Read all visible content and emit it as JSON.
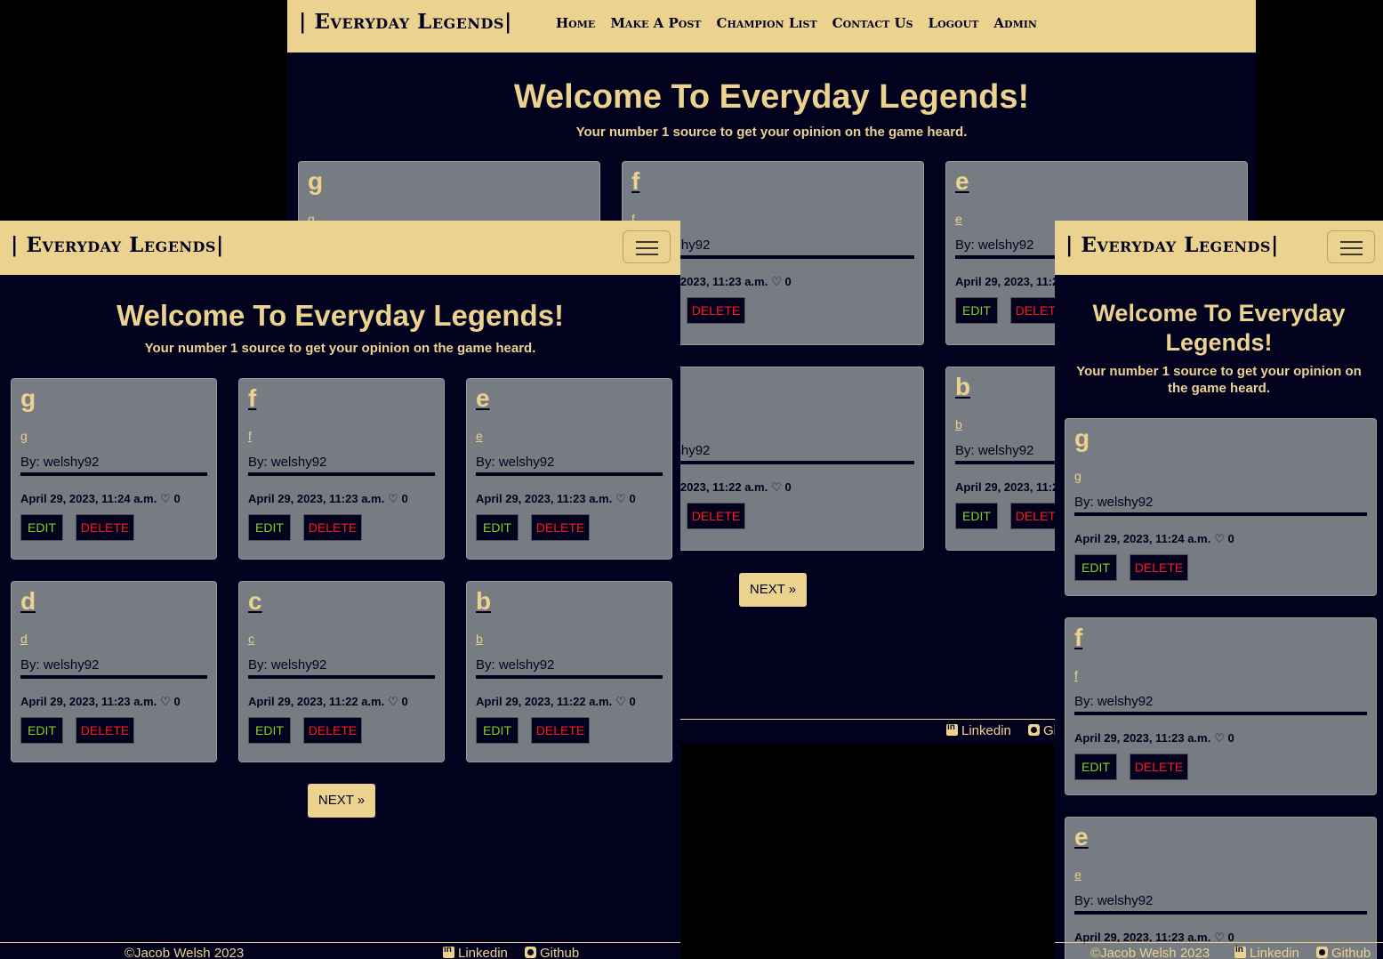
{
  "brand": "| Everyday Legends|",
  "nav": [
    "Home",
    "Make A Post",
    "Champion List",
    "Contact Us",
    "Logout",
    "Admin"
  ],
  "hero": {
    "title": "Welcome To Everyday Legends!",
    "subtitle": "Your number 1 source to get your opinion on the game heard."
  },
  "posts": [
    {
      "title": "g",
      "excerpt": "g",
      "author": "By: welshy92",
      "date": "April 29, 2023, 11:24 a.m.",
      "likes": "0"
    },
    {
      "title": "f",
      "excerpt": "f",
      "author": "By: welshy92",
      "date": "April 29, 2023, 11:23 a.m.",
      "likes": "0"
    },
    {
      "title": "e",
      "excerpt": "e",
      "author": "By: welshy92",
      "date": "April 29, 2023, 11:23 a.m.",
      "likes": "0"
    },
    {
      "title": "d",
      "excerpt": "d",
      "author": "By: welshy92",
      "date": "April 29, 2023, 11:23 a.m.",
      "likes": "0"
    },
    {
      "title": "c",
      "excerpt": "c",
      "author": "By: welshy92",
      "date": "April 29, 2023, 11:22 a.m.",
      "likes": "0"
    },
    {
      "title": "b",
      "excerpt": "b",
      "author": "By: welshy92",
      "date": "April 29, 2023, 11:22 a.m.",
      "likes": "0"
    }
  ],
  "buttons": {
    "edit": "EDIT",
    "delete": "DELETE",
    "next": "NEXT »"
  },
  "footer": {
    "copyright": "©Jacob Welsh 2023",
    "linkedin": "Linkedin",
    "github": "Github"
  }
}
